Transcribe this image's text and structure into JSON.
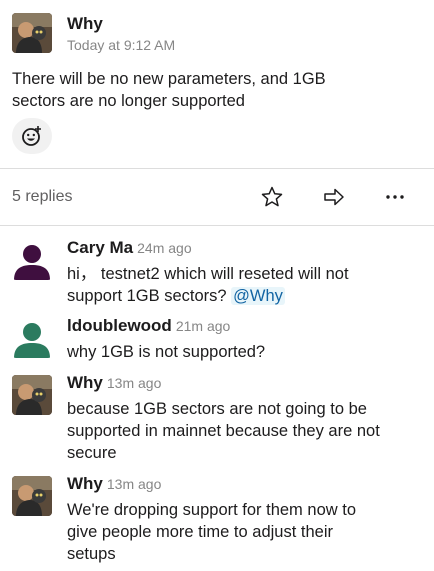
{
  "parent_message": {
    "author": "Why",
    "timestamp": "Today at 9:12 AM",
    "text_line1": "There will be no new parameters, and 1GB",
    "text_line2": "sectors are no longer supported"
  },
  "thread": {
    "replies_label": "5 replies"
  },
  "replies": [
    {
      "author": "Cary Ma",
      "time": "24m ago",
      "line1": "hi，  testnet2 which will reseted will not",
      "line2_prefix": "support 1GB sectors? ",
      "mention": "@Why",
      "avatar_color": "#3f0f3f"
    },
    {
      "author": "ldoublewood",
      "time": "21m ago",
      "line1": "why 1GB is not supported?",
      "avatar_color": "#2b7b5f"
    },
    {
      "author": "Why",
      "time": "13m ago",
      "line1": "because 1GB sectors are not going to be",
      "line2": "supported in mainnet because they are not",
      "line3": "secure"
    },
    {
      "author": "Why",
      "time": "13m ago",
      "line1": "We're dropping support for them now to",
      "line2": "give people more time to adjust their",
      "line3": "setups"
    }
  ],
  "icons": {
    "add_reaction": "add-reaction-icon",
    "star": "star-icon",
    "share": "share-icon",
    "more": "more-icon"
  }
}
